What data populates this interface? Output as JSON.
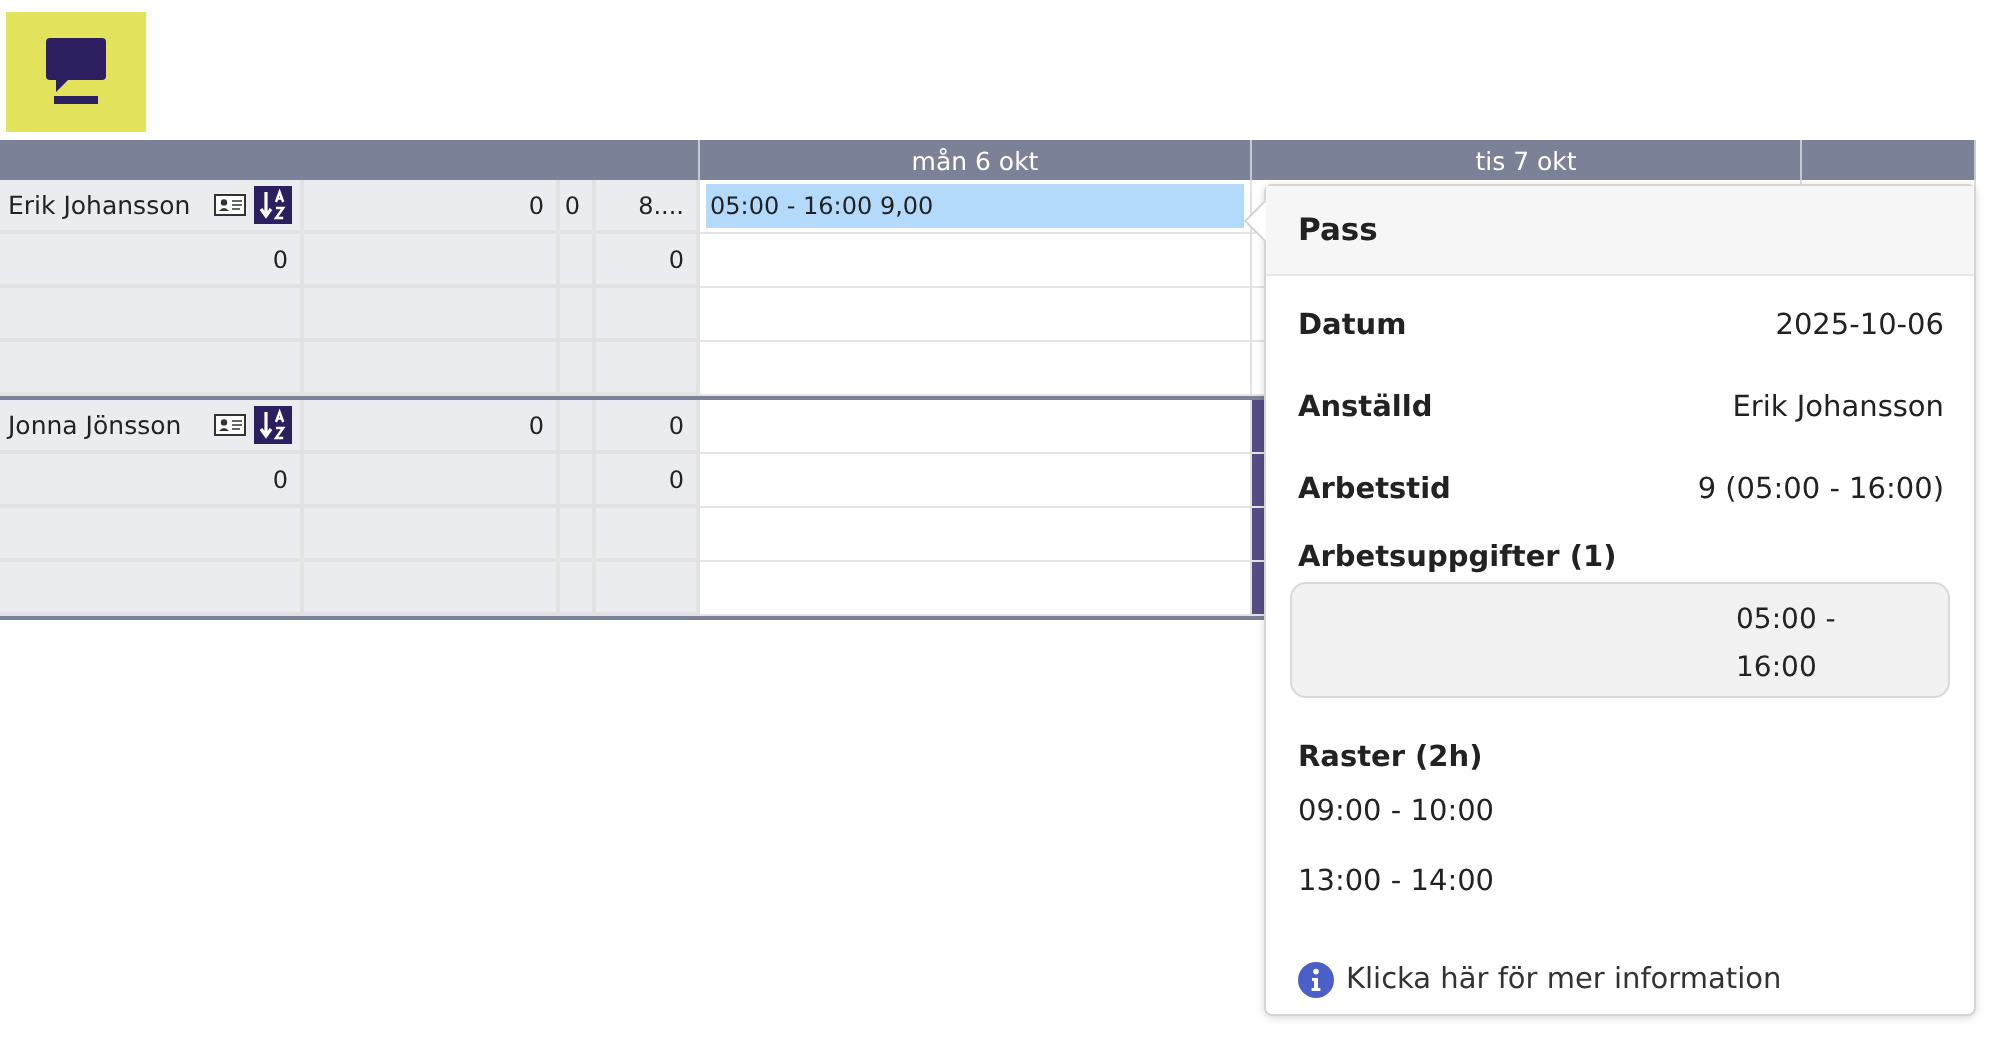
{
  "header": {
    "days": [
      "mån 6 okt",
      "tis 7 okt"
    ]
  },
  "employees": [
    {
      "name": "Erik Johansson",
      "rows": [
        [
          "",
          "0",
          "0",
          "8...."
        ],
        [
          "0",
          "",
          "",
          "0"
        ],
        [
          "",
          "",
          "",
          ""
        ],
        [
          "",
          "",
          "",
          ""
        ]
      ],
      "days": [
        {
          "shift": "05:00 - 16:00 9,00",
          "marked": false
        }
      ]
    },
    {
      "name": "Jonna Jönsson",
      "rows": [
        [
          "",
          "0",
          "",
          "0"
        ],
        [
          "0",
          "",
          "",
          "0"
        ],
        [
          "",
          "",
          "",
          ""
        ],
        [
          "",
          "",
          "",
          ""
        ]
      ],
      "days": [
        {
          "marked": false
        },
        {
          "marked": true
        }
      ]
    }
  ],
  "popover": {
    "title": "Pass",
    "fields": [
      {
        "label": "Datum",
        "value": "2025-10-06"
      },
      {
        "label": "Anställd",
        "value": "Erik Johansson"
      },
      {
        "label": "Arbetstid",
        "value": "9 (05:00 - 16:00)"
      }
    ],
    "tasks_heading": "Arbetsuppgifter (1)",
    "tasks": [
      "05:00 - 16:00"
    ],
    "breaks_heading": "Raster (2h)",
    "breaks": [
      "09:00 - 10:00",
      "13:00 - 14:00"
    ],
    "link": "Klicka här för mer information"
  }
}
